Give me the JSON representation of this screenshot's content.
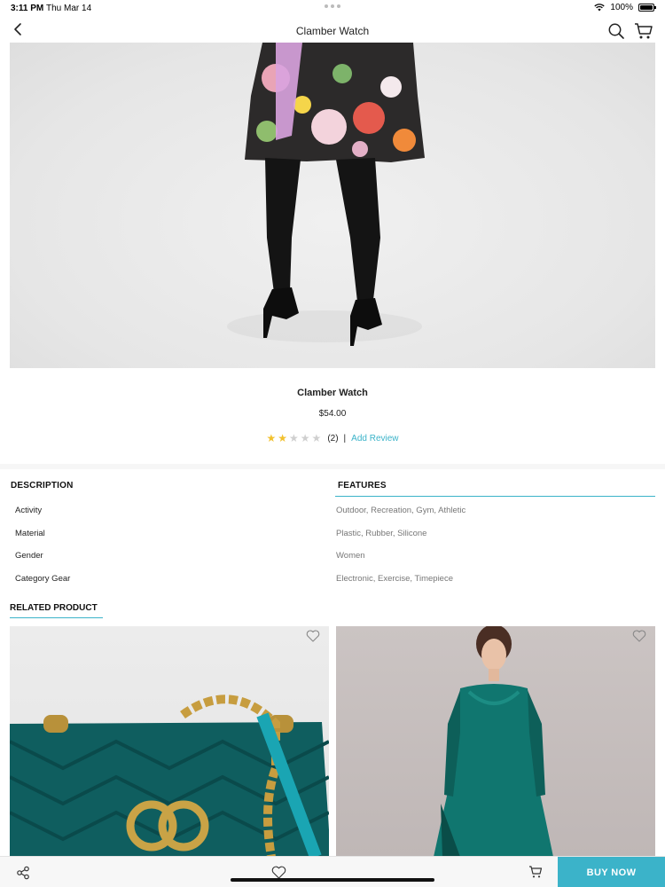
{
  "status": {
    "time": "3:11 PM",
    "date": "Thu Mar 14",
    "battery": "100%",
    "battery_level": 1.0
  },
  "nav": {
    "title": "Clamber Watch",
    "back_icon": "chevron-left-icon",
    "search_icon": "search-icon",
    "cart_icon": "cart-icon"
  },
  "product": {
    "name": "Clamber Watch",
    "price": "$54.00",
    "rating": 2,
    "rating_max": 5,
    "review_count": "(2)",
    "separator": "|",
    "add_review": "Add Review",
    "star_color_on": "#f2c12e",
    "star_color_off": "#cfcfcf"
  },
  "description": {
    "heading": "DESCRIPTION",
    "features_heading": "FEATURES",
    "rows": [
      {
        "label": "Activity",
        "value": "Outdoor, Recreation, Gym, Athletic"
      },
      {
        "label": "Material",
        "value": "Plastic, Rubber, Silicone"
      },
      {
        "label": "Gender",
        "value": "Women"
      },
      {
        "label": "Category Gear",
        "value": "Electronic, Exercise, Timepiece"
      }
    ]
  },
  "related": {
    "heading": "RELATED PRODUCT",
    "items": [
      {
        "image": "teal velvet chain shoulder bag",
        "favorite_icon": "heart-outline-icon"
      },
      {
        "image": "woman in teal lace dress",
        "favorite_icon": "heart-outline-icon"
      }
    ]
  },
  "bottom_bar": {
    "share_icon": "share-icon",
    "wishlist_icon": "heart-outline-icon",
    "cart_icon": "add-to-cart-icon",
    "buy_label": "BUY NOW"
  },
  "colors": {
    "accent": "#3bb3c9"
  }
}
